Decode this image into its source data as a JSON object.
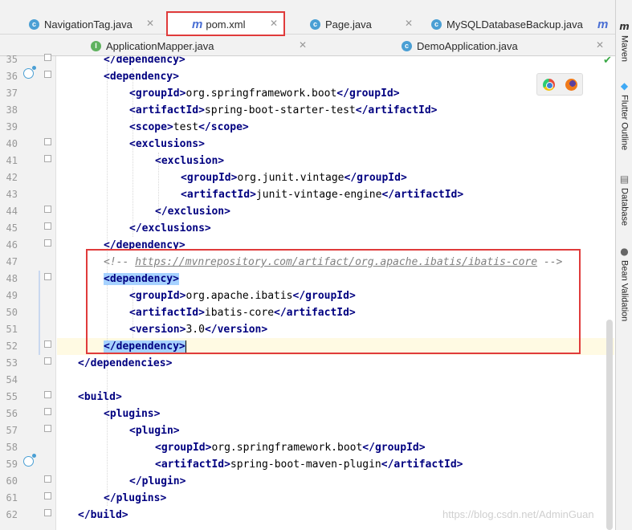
{
  "tabs_row1": [
    {
      "label": "NavigationTag.java",
      "icon": "class-icon",
      "active": false
    },
    {
      "label": "pom.xml",
      "icon": "maven-icon",
      "active": true
    },
    {
      "label": "Page.java",
      "icon": "class-icon",
      "active": false
    },
    {
      "label": "MySQLDatabaseBackup.java",
      "icon": "class-icon",
      "active": false
    },
    {
      "label": "m",
      "icon": "maven-icon",
      "active": false
    }
  ],
  "tabs_row2": [
    {
      "label": "ApplicationMapper.java",
      "icon": "interface-icon"
    },
    {
      "label": "DemoApplication.java",
      "icon": "class-icon"
    }
  ],
  "tool_windows": [
    {
      "label": "Maven",
      "icon": "maven-icon"
    },
    {
      "label": "Flutter Outline",
      "icon": "flutter-icon"
    },
    {
      "label": "Database",
      "icon": "database-icon"
    },
    {
      "label": "Bean Validation",
      "icon": "bean-icon"
    }
  ],
  "editor": {
    "lines": [
      {
        "num": "35"
      },
      {
        "num": "36"
      },
      {
        "num": "37"
      },
      {
        "num": "38"
      },
      {
        "num": "39"
      },
      {
        "num": "40"
      },
      {
        "num": "41"
      },
      {
        "num": "42"
      },
      {
        "num": "43"
      },
      {
        "num": "44"
      },
      {
        "num": "45"
      },
      {
        "num": "46"
      },
      {
        "num": "47"
      },
      {
        "num": "48"
      },
      {
        "num": "49"
      },
      {
        "num": "50"
      },
      {
        "num": "51"
      },
      {
        "num": "52"
      },
      {
        "num": "53"
      },
      {
        "num": "54"
      },
      {
        "num": "55"
      },
      {
        "num": "56"
      },
      {
        "num": "57"
      },
      {
        "num": "58"
      },
      {
        "num": "59"
      },
      {
        "num": "60"
      },
      {
        "num": "61"
      },
      {
        "num": "62"
      }
    ],
    "code": {
      "l35": "</dependency>",
      "l36": "<dependency>",
      "l37_open": "<groupId>",
      "l37_val": "org.springframework.boot",
      "l37_close": "</groupId>",
      "l38_open": "<artifactId>",
      "l38_val": "spring-boot-starter-test",
      "l38_close": "</artifactId>",
      "l39_open": "<scope>",
      "l39_val": "test",
      "l39_close": "</scope>",
      "l40": "<exclusions>",
      "l41": "<exclusion>",
      "l42_open": "<groupId>",
      "l42_val": "org.junit.vintage",
      "l42_close": "</groupId>",
      "l43_open": "<artifactId>",
      "l43_val": "junit-vintage-engine",
      "l43_close": "</artifactId>",
      "l44": "</exclusion>",
      "l45": "</exclusions>",
      "l46": "</dependency>",
      "l47_start": "<!-- ",
      "l47_link": "https://mvnrepository.com/artifact/org.apache.ibatis/ibatis-core",
      "l47_end": " -->",
      "l48": "<dependency>",
      "l49_open": "<groupId>",
      "l49_val": "org.apache.ibatis",
      "l49_close": "</groupId>",
      "l50_open": "<artifactId>",
      "l50_val": "ibatis-core",
      "l50_close": "</artifactId>",
      "l51_open": "<version>",
      "l51_val": "3.0",
      "l51_close": "</version>",
      "l52": "</dependency>",
      "l53": "</dependencies>",
      "l55": "<build>",
      "l56": "<plugins>",
      "l57": "<plugin>",
      "l58_open": "<groupId>",
      "l58_val": "org.springframework.boot",
      "l58_close": "</groupId>",
      "l59_open": "<artifactId>",
      "l59_val": "spring-boot-maven-plugin",
      "l59_close": "</artifactId>",
      "l60": "</plugin>",
      "l61": "</plugins>",
      "l62": "</build>"
    }
  },
  "watermark": "https://blog.csdn.net/AdminGuan",
  "colors": {
    "tag": "#000080",
    "comment": "#808080",
    "highlight_box": "#e03b3b",
    "selection": "#a6d2ff"
  }
}
